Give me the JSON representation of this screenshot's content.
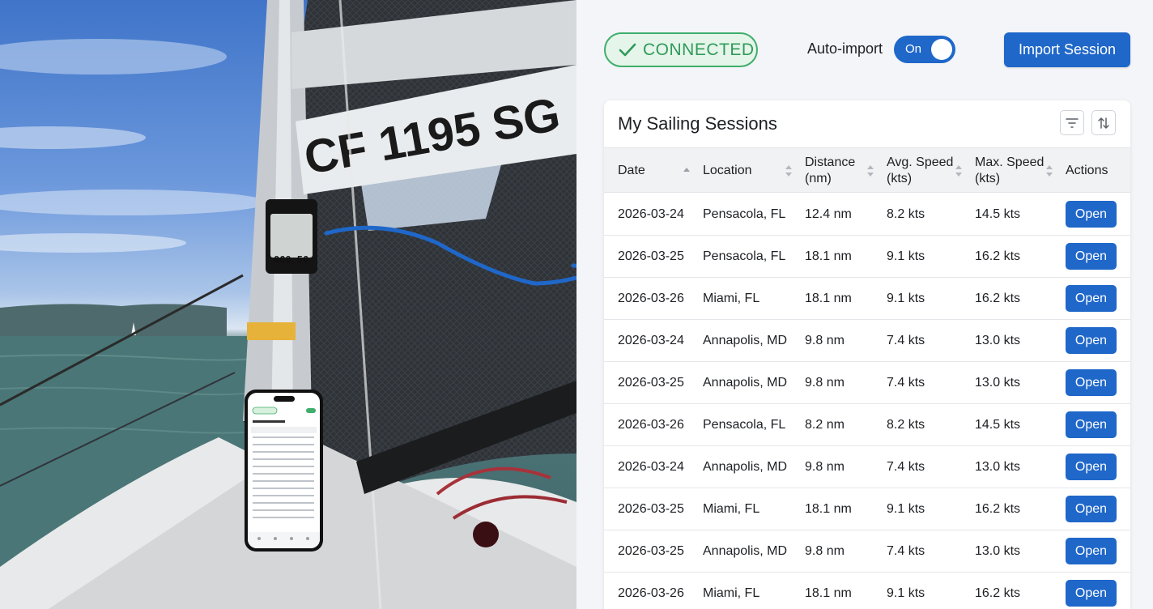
{
  "photo": {
    "sail_number": "CF 1195 SG",
    "device_display": "060 56"
  },
  "header": {
    "status": "CONNECTED",
    "auto_import_label": "Auto-import",
    "auto_import_state": "On",
    "import_button": "Import Session"
  },
  "colors": {
    "accent": "#1f67c9",
    "connected_green": "#2f9a5a",
    "connected_bg": "#e6f5ea"
  },
  "sessions": {
    "title": "My Sailing Sessions",
    "icons": [
      "filter-icon",
      "sort-icon"
    ],
    "columns": [
      "Date",
      "Location",
      "Distance\n(nm)",
      "Avg. Speed\n(kts)",
      "Max. Speed\n(kts)",
      "Actions"
    ],
    "rows": [
      {
        "date": "2026-03-24",
        "location": "Pensacola, FL",
        "distance": "12.4 nm",
        "avg": "8.2 kts",
        "max": "14.5 kts",
        "action": "Open"
      },
      {
        "date": "2026-03-25",
        "location": "Pensacola, FL",
        "distance": "18.1 nm",
        "avg": "9.1 kts",
        "max": "16.2 kts",
        "action": "Open"
      },
      {
        "date": "2026-03-26",
        "location": "Miami, FL",
        "distance": "18.1 nm",
        "avg": "9.1 kts",
        "max": "16.2 kts",
        "action": "Open"
      },
      {
        "date": "2026-03-24",
        "location": "Annapolis, MD",
        "distance": "9.8 nm",
        "avg": "7.4 kts",
        "max": "13.0 kts",
        "action": "Open"
      },
      {
        "date": "2026-03-25",
        "location": "Annapolis, MD",
        "distance": "9.8 nm",
        "avg": "7.4 kts",
        "max": "13.0 kts",
        "action": "Open"
      },
      {
        "date": "2026-03-26",
        "location": "Pensacola, FL",
        "distance": "8.2 nm",
        "avg": "8.2 kts",
        "max": "14.5 kts",
        "action": "Open"
      },
      {
        "date": "2026-03-24",
        "location": "Annapolis, MD",
        "distance": "9.8 nm",
        "avg": "7.4 kts",
        "max": "13.0 kts",
        "action": "Open"
      },
      {
        "date": "2026-03-25",
        "location": "Miami, FL",
        "distance": "18.1 nm",
        "avg": "9.1 kts",
        "max": "16.2 kts",
        "action": "Open"
      },
      {
        "date": "2026-03-25",
        "location": "Annapolis, MD",
        "distance": "9.8 nm",
        "avg": "7.4 kts",
        "max": "13.0 kts",
        "action": "Open"
      },
      {
        "date": "2026-03-26",
        "location": "Miami, FL",
        "distance": "18.1 nm",
        "avg": "9.1 kts",
        "max": "16.2 kts",
        "action": "Open"
      }
    ]
  }
}
